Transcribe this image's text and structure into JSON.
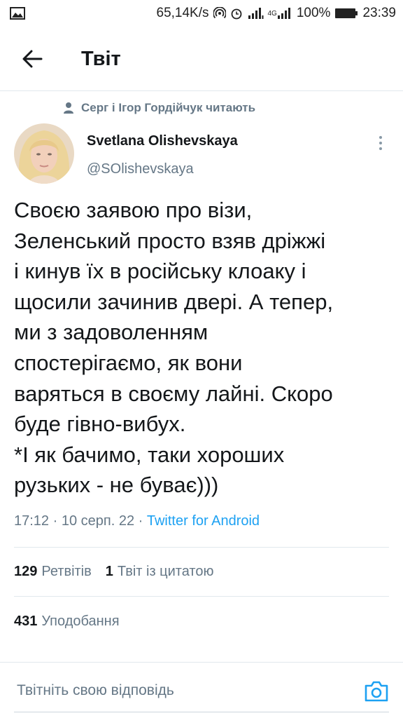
{
  "status_bar": {
    "net_speed": "65,14K/s",
    "network_label": "4G",
    "battery": "100%",
    "time": "23:39"
  },
  "header": {
    "title": "Твіт"
  },
  "social_context": {
    "text": "Серг і Ігор Гордійчук читають"
  },
  "tweet": {
    "author_name": "Svetlana Olishevskaya",
    "author_handle": "@SOlishevskaya",
    "text": "Своєю заявою про візи,\nЗеленський просто взяв дріжжі\nі кинув їх в російську клоаку і\nщосили зачинив двері. А тепер,\nми з задоволенням\nспостерігаємо, як вони\nваряться в своєму лайні. Скоро\nбуде гівно-вибух.\n*І як бачимо, таки хороших\nрузьких - не буває)))",
    "time": "17:12",
    "date": "10 серп. 22",
    "source": "Twitter for Android"
  },
  "stats": {
    "retweets_count": "129",
    "retweets_label": "Ретвітів",
    "quotes_count": "1",
    "quotes_label": "Твіт із цитатою",
    "likes_count": "431",
    "likes_label": "Уподобання"
  },
  "reply": {
    "placeholder": "Твітніть свою відповідь"
  },
  "colors": {
    "accent": "#1da1f2",
    "secondary_text": "#657786",
    "primary_text": "#14171a",
    "divider": "#e1e8ed"
  },
  "icons": {
    "back": "arrow-left-icon",
    "more": "vertical-ellipsis-icon",
    "person": "person-icon",
    "camera": "camera-icon"
  }
}
